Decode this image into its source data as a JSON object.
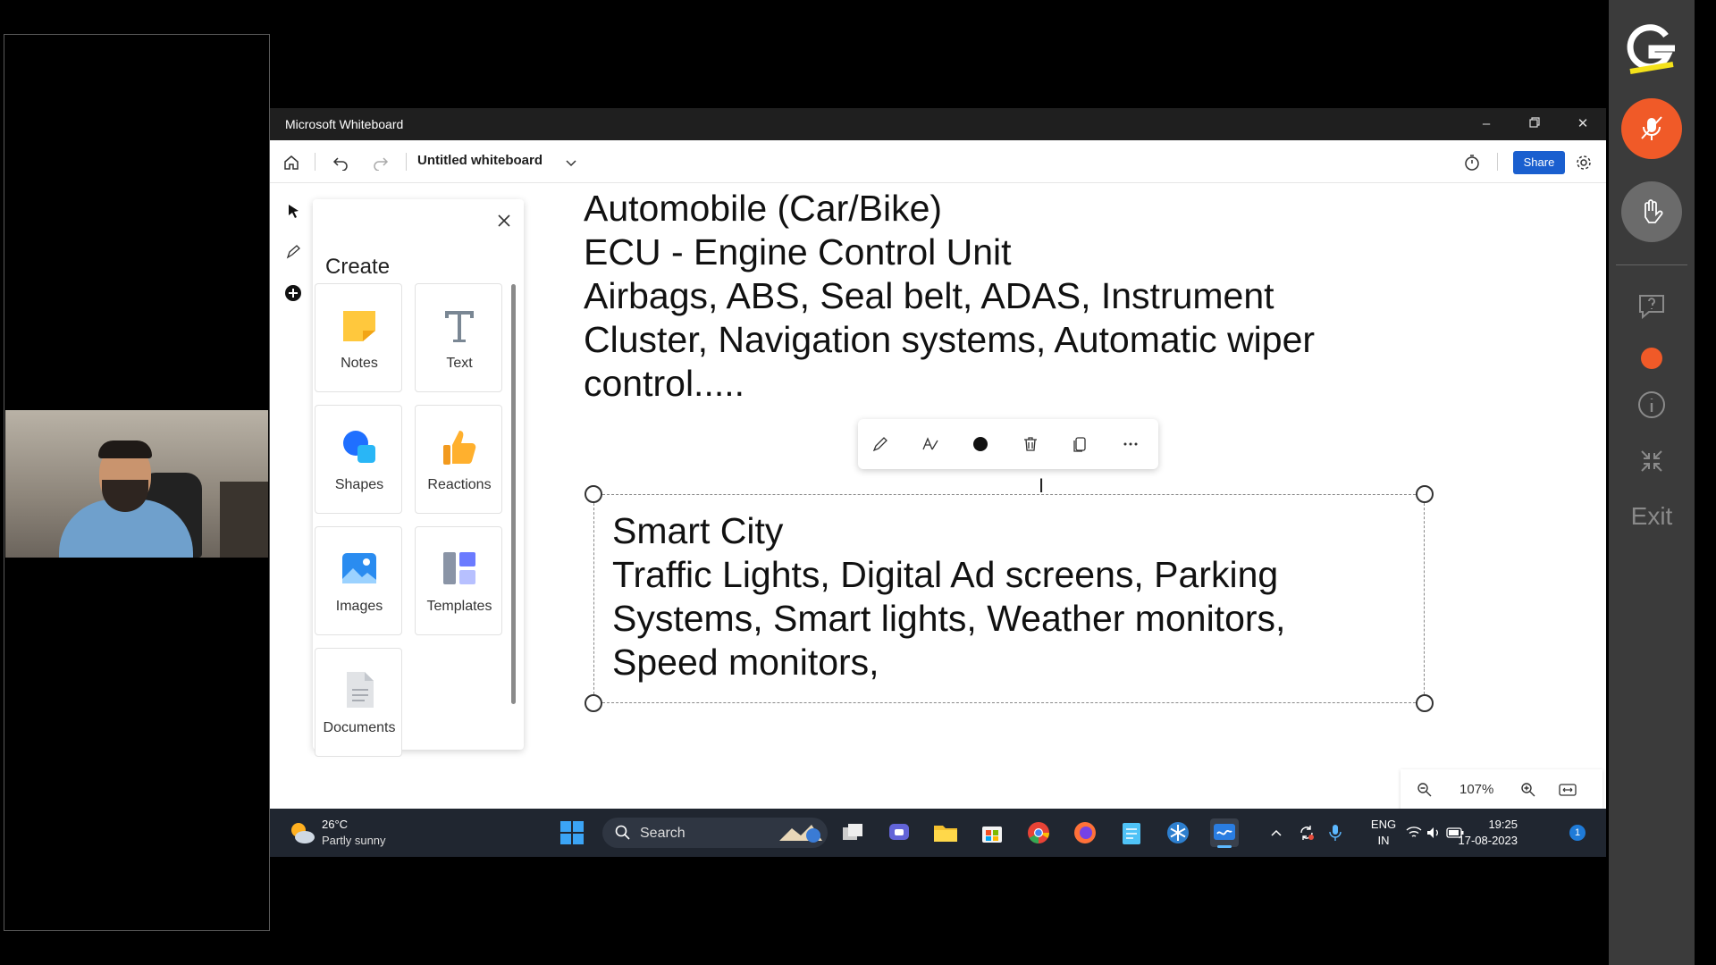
{
  "window": {
    "title": "Microsoft Whiteboard"
  },
  "toolbar": {
    "board_title": "Untitled whiteboard",
    "share_label": "Share"
  },
  "create_panel": {
    "title": "Create",
    "tiles": [
      {
        "label": "Notes",
        "icon": "sticky-note-icon"
      },
      {
        "label": "Text",
        "icon": "text-icon"
      },
      {
        "label": "Shapes",
        "icon": "shapes-icon"
      },
      {
        "label": "Reactions",
        "icon": "thumbs-up-icon"
      },
      {
        "label": "Images",
        "icon": "image-icon"
      },
      {
        "label": "Templates",
        "icon": "templates-icon"
      },
      {
        "label": "Documents",
        "icon": "document-icon"
      }
    ]
  },
  "board": {
    "block1": [
      "Automobile (Car/Bike)",
      "ECU - Engine Control Unit",
      "Airbags, ABS, Seal belt, ADAS, Instrument",
      "Cluster, Navigation systems, Automatic wiper",
      "control....."
    ],
    "block2": [
      "Smart City",
      "Traffic Lights, Digital Ad screens, Parking",
      "Systems, Smart lights, Weather monitors,",
      "Speed monitors,"
    ]
  },
  "zoom": {
    "level": "107%"
  },
  "taskbar": {
    "weather_temp": "26°C",
    "weather_cond": "Partly sunny",
    "search_label": "Search",
    "lang_line1": "ENG",
    "lang_line2": "IN",
    "time": "19:25",
    "date": "17-08-2023",
    "notification_count": "1"
  },
  "right_bar": {
    "exit_label": "Exit",
    "mic_color": "#f05a28",
    "record_color": "#f05a28"
  },
  "colors": {
    "accent": "#1a5fcf",
    "titlebar": "#1f1f1f",
    "taskbar": "#202630"
  }
}
